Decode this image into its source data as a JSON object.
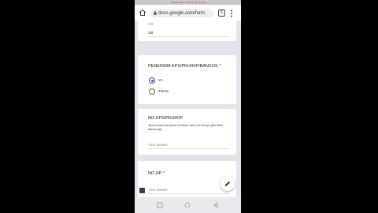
{
  "status_bar": {
    "notice": "\"Screen Cast\" running · tap to stop"
  },
  "browser": {
    "url": "docs.google.com/form",
    "tab_count": "6"
  },
  "form": {
    "scale_card": {
      "value_faded": "1/3",
      "value": "1/0"
    },
    "kps_card": {
      "title": "PENERIMA KPS/PKH/KIP/BANSOS *",
      "options": [
        {
          "label": "YA",
          "selected": true
        },
        {
          "label": "TIDAK",
          "selected": false
        }
      ]
    },
    "kip_card": {
      "title": "NO.KPS/PKH/KIP",
      "description": "Jika menerima kartu bantuan tulis nomernya jika tidak dikosongi",
      "placeholder": "Your answer"
    },
    "hp_card": {
      "title": "NO.HP *",
      "placeholder": "Your answer"
    }
  },
  "colors": {
    "accent": "#673ab7",
    "page_bg": "#e6e3ec"
  },
  "icons": [
    "home-icon",
    "lock-icon",
    "tab-icon",
    "menu-icon",
    "edit-icon",
    "back-icon",
    "home-nav-icon",
    "recents-icon"
  ]
}
